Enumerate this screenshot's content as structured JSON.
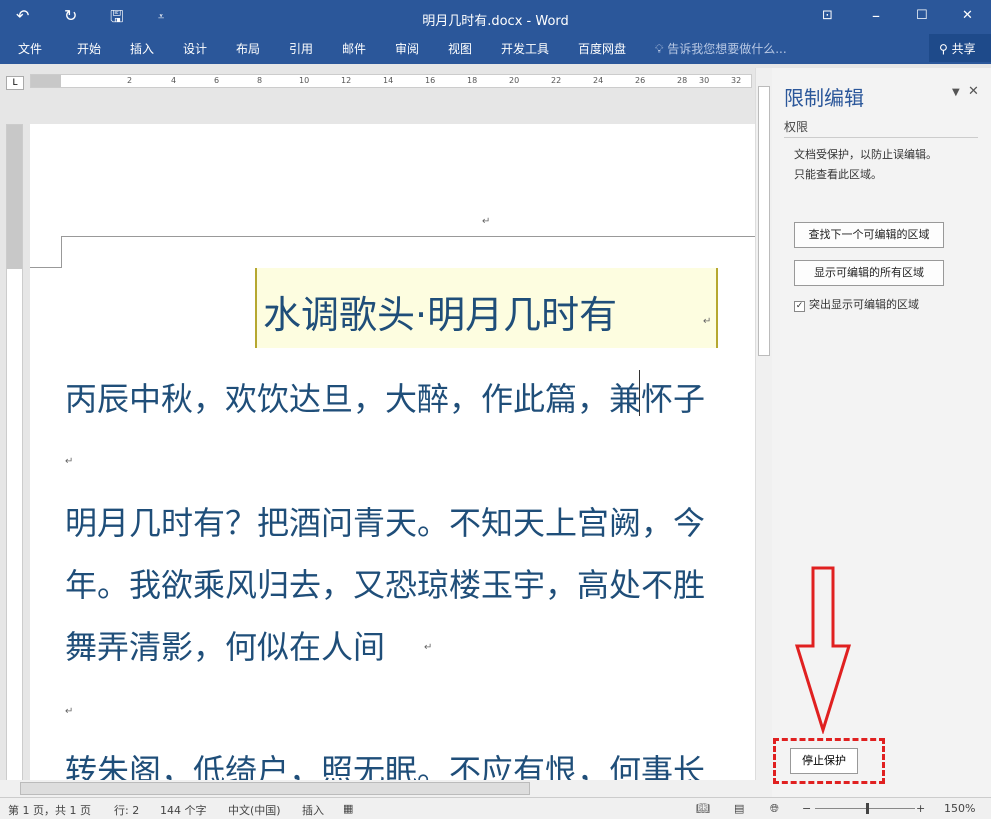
{
  "titlebar": {
    "title": "明月几时有.docx - Word",
    "undo": "↶",
    "redo": "↻",
    "save": "🖫",
    "customize": "⩡",
    "ribbon_display": "⊡",
    "minimize": "–",
    "maximize": "☐",
    "close": "✕"
  },
  "tabs": [
    "文件",
    "开始",
    "插入",
    "设计",
    "布局",
    "引用",
    "邮件",
    "审阅",
    "视图",
    "开发工具",
    "百度网盘"
  ],
  "tell_me": "告诉我您想要做什么...",
  "share": "共享",
  "ruler": {
    "corner": "L",
    "ticks": [
      "2",
      "4",
      "6",
      "8",
      "10",
      "12",
      "14",
      "16",
      "18",
      "20",
      "22",
      "24",
      "26",
      "28",
      "30",
      "32"
    ]
  },
  "document": {
    "title": "水调歌头·明月几时有",
    "lines": [
      "丙辰中秋，欢饮达旦，大醉，作此篇，兼怀子",
      "明月几时有？把酒问青天。不知天上宫阙，今",
      "年。我欲乘风归去，又恐琼楼玉宇，高处不胜",
      "舞弄清影，何似在人间",
      "转朱阁，低绮户，照无眠。不应有恨，何事长"
    ],
    "return_mark": "↵"
  },
  "pane": {
    "title": "限制编辑",
    "section": "权限",
    "desc1": "文档受保护，以防止误编辑。",
    "desc2": "只能查看此区域。",
    "find_next": "查找下一个可编辑的区域",
    "show_all": "显示可编辑的所有区域",
    "highlight": "突出显示可编辑的区域",
    "highlight_checked": true,
    "stop": "停止保护"
  },
  "status": {
    "page": "第 1 页，共 1 页",
    "line": "行: 2",
    "words": "144 个字",
    "lang": "中文(中国)",
    "mode": "插入",
    "zoom": "150%",
    "zoom_minus": "−",
    "zoom_plus": "+"
  }
}
